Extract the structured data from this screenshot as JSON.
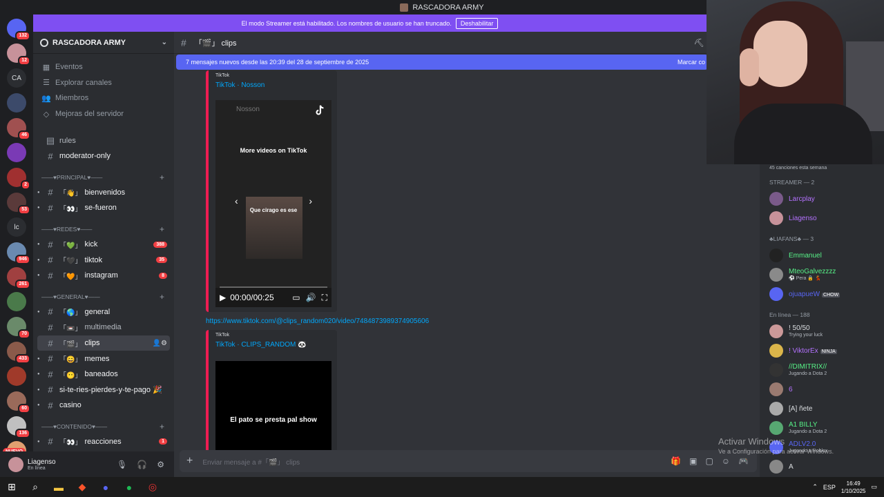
{
  "window": {
    "title": "RASCADORA ARMY"
  },
  "streamer_banner": {
    "text": "El modo Streamer está habilitado. Los nombres de usuario se han truncado.",
    "button": "Deshabilitar"
  },
  "server_rail": {
    "badges": [
      "132",
      "12",
      "7",
      "46",
      "2",
      "53",
      "946",
      "261",
      "70",
      "433",
      "60",
      "136",
      "1",
      "520"
    ],
    "text_servers": [
      "CA",
      "lc"
    ],
    "new_label": "NUEVO"
  },
  "guild": {
    "name": "RASCADORA ARMY",
    "nav": [
      "Eventos",
      "Explorar canales",
      "Miembros",
      "Mejoras del servidor"
    ],
    "top_channels": [
      {
        "name": "rules",
        "dim": true
      },
      {
        "name": "moderator-only",
        "dim": false
      }
    ],
    "categories": {
      "principal": "——♥PRINCIPAL♥——",
      "redes": "——♥REDES♥——",
      "general": "——♥GENERAL♥——",
      "contenido": "——♥CONTENIDO♥——"
    },
    "principal_channels": [
      {
        "emoji": "「👋」",
        "name": "bienvenidos"
      },
      {
        "emoji": "「👀」",
        "name": "se-fueron"
      }
    ],
    "redes_channels": [
      {
        "emoji": "「💚」",
        "name": "kick",
        "count": "388"
      },
      {
        "emoji": "「🖤」",
        "name": "tiktok",
        "count": "35"
      },
      {
        "emoji": "「🧡」",
        "name": "instagram",
        "count": "8"
      }
    ],
    "general_channels": [
      {
        "emoji": "「🌎」",
        "name": "general"
      },
      {
        "emoji": "「📼」",
        "name": "multimedia"
      },
      {
        "emoji": "「🎬」",
        "name": "clips"
      },
      {
        "emoji": "「😄」",
        "name": "memes"
      },
      {
        "emoji": "「😶」",
        "name": "baneados"
      },
      {
        "emoji": "",
        "name": "si-te-ries-pierdes-y-te-pago 🎉"
      },
      {
        "emoji": "",
        "name": "casino"
      }
    ],
    "contenido_channels": [
      {
        "emoji": "「👀」",
        "name": "reacciones",
        "count": "1"
      }
    ]
  },
  "user_panel": {
    "name": "Liagenso",
    "status": "En línea"
  },
  "chat": {
    "channel": "「🎬」 clips",
    "new_messages": "7 mensajes nuevos desde las 20:39 del 28 de septiembre de 2025",
    "mark_read": "Marcar co",
    "embed1": {
      "provider": "TikTok",
      "title": "TikTok · Nosson",
      "overlay_title": "More videos on TikTok",
      "caption": "Que cirago es ese",
      "faded_name": "Nosson",
      "time": "00:00/00:25"
    },
    "link": "https://www.tiktok.com/@clips_random020/video/7484873989374905606",
    "embed2": {
      "provider": "TikTok",
      "title": "TikTok · CLIPS_RANDOM 🐼",
      "caption": "El pato se presta pal show"
    },
    "composer_placeholder": "Enviar mensaje a #「🎬」 clips"
  },
  "members": {
    "weekly": "45 canciones esta semana",
    "groups": [
      {
        "label": "STREAMER — 2",
        "members": [
          {
            "name": "Larcplay",
            "color": "#b472ff",
            "sub": "",
            "avatar": "#7a5a8a"
          },
          {
            "name": "Liagenso",
            "color": "#b472ff",
            "sub": "",
            "avatar": "#c7929a"
          }
        ]
      },
      {
        "label": "♣LIAFANS♣ — 3",
        "members": [
          {
            "name": "Emmanuel",
            "color": "#57f287",
            "sub": "",
            "avatar": "#222"
          },
          {
            "name": "MteoGalvezzzz",
            "color": "#57f287",
            "sub": "⚽ Pera 🔒 💃",
            "avatar": "#8a8a8a"
          },
          {
            "name": "ojuapueW",
            "color": "#5865f2",
            "sub": "",
            "tag": "CHOW",
            "avatar": "#5865f2"
          }
        ]
      },
      {
        "label": "En línea — 188",
        "members": [
          {
            "name": "! 50/50",
            "color": "#dbdee1",
            "sub": "Trying your luck",
            "avatar": "#c99"
          },
          {
            "name": "! ViktorEx",
            "color": "#b472ff",
            "sub": "",
            "tag": "NINJA",
            "avatar": "#dbb54a"
          },
          {
            "name": "//DIMITRIX//",
            "color": "#57f287",
            "sub": "Jugando a Dota 2",
            "avatar": "#333"
          },
          {
            "name": "6",
            "color": "#b472ff",
            "sub": "",
            "avatar": "#9a7a70"
          },
          {
            "name": "[A] ñete",
            "color": "#dbdee1",
            "sub": "",
            "avatar": "#aaa"
          },
          {
            "name": "A1 BILLY",
            "color": "#57f287",
            "sub": "Jugando a Dota 2",
            "avatar": "#57a872"
          },
          {
            "name": "ADLV2.0",
            "color": "#5865f2",
            "sub": "Jugando a Roblox",
            "avatar": "#5865f2"
          },
          {
            "name": "A",
            "color": "#dbdee1",
            "sub": "",
            "avatar": "#888"
          }
        ]
      }
    ]
  },
  "windows": {
    "activate_title": "Activar Windows",
    "activate_sub": "Ve a Configuración para activar Windows.",
    "lang": "ESP",
    "time": "16:49",
    "date": "1/10/2025"
  }
}
